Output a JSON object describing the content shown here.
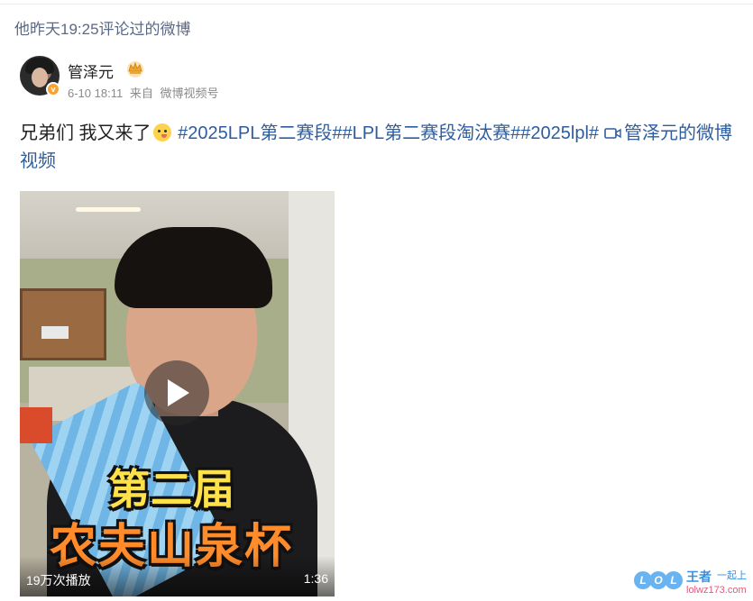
{
  "comment_note": "他昨天19:25评论过的微博",
  "author": {
    "name": "管泽元",
    "badge_icon": "crown-icon",
    "verified_icon": "verified-badge-icon"
  },
  "meta": {
    "time": "6-10 18:11",
    "from_label": "来自",
    "source": "微博视频号"
  },
  "post": {
    "text_before": "兄弟们 我又来了",
    "emoji": "smirk-emoji-icon",
    "topics": "#2025LPL第二赛段##LPL第二赛段淘汰赛##2025lpl#",
    "video_link_label": "管泽元的微博视频"
  },
  "video": {
    "overlay_line1": "第二届",
    "overlay_line2": "农夫山泉杯",
    "view_count": "19万次播放",
    "duration": "1:36"
  },
  "watermark": {
    "letters": [
      "L",
      "O",
      "L"
    ],
    "title": "王者",
    "subtitle": "一起上",
    "url": "lolwz173.com"
  },
  "colors": {
    "link": "#2d5d9f",
    "meta": "#8a8a8a",
    "verified": "#f7a234"
  }
}
